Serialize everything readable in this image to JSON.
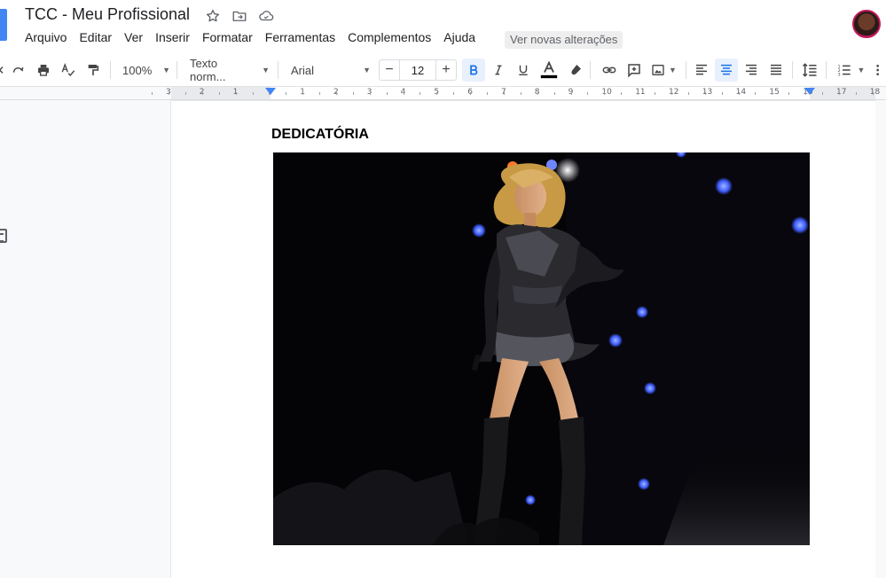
{
  "document": {
    "title": "TCC - Meu Profissional",
    "heading": "DEDICATÓRIA"
  },
  "menu": {
    "items": [
      "Arquivo",
      "Editar",
      "Ver",
      "Inserir",
      "Formatar",
      "Ferramentas",
      "Complementos",
      "Ajuda"
    ],
    "changes_label": "Ver novas alterações"
  },
  "toolbar": {
    "zoom": "100%",
    "style": "Texto norm...",
    "font": "Arial",
    "font_size": "12",
    "decrease": "−",
    "increase": "+"
  },
  "ruler": {
    "numbers": [
      "3",
      "2",
      "1",
      "1",
      "2",
      "3",
      "4",
      "5",
      "6",
      "7",
      "8",
      "9",
      "10",
      "11",
      "12",
      "13",
      "14",
      "15",
      "16",
      "17",
      "18"
    ]
  },
  "icons": {
    "star": "star-icon",
    "move": "move-to-folder-icon",
    "cloud": "cloud-saved-icon"
  },
  "colors": {
    "accent": "#1a73e8",
    "logo": "#4285f4",
    "avatar_ring": "#c2185b"
  }
}
